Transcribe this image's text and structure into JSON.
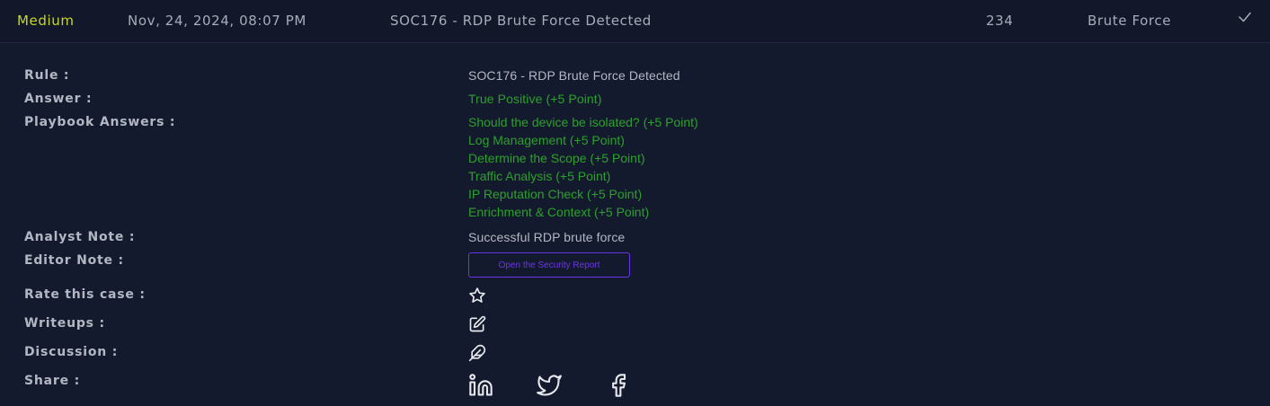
{
  "header": {
    "severity": "Medium",
    "date": "Nov, 24, 2024, 08:07 PM",
    "rule_name": "SOC176 - RDP Brute Force Detected",
    "event_id": "234",
    "type": "Brute Force",
    "check_icon": "checkmark-icon"
  },
  "details": {
    "rule_label": "Rule :",
    "rule_value": "SOC176 - RDP Brute Force Detected",
    "answer_label": "Answer :",
    "answer_value": "True Positive (+5 Point)",
    "playbook_label": "Playbook Answers :",
    "playbook_answers": [
      "Should the device be isolated? (+5 Point)",
      "Log Management (+5 Point)",
      "Determine the Scope (+5 Point)",
      "Traffic Analysis (+5 Point)",
      "IP Reputation Check (+5 Point)",
      "Enrichment & Context (+5 Point)"
    ],
    "analyst_note_label": "Analyst Note :",
    "analyst_note_value": "Successful RDP brute force",
    "editor_note_label": "Editor Note :",
    "report_button": "Open the Security Report",
    "rate_label": "Rate this case :",
    "rate_icon": "star-icon",
    "writeups_label": "Writeups :",
    "writeups_icon": "edit-icon",
    "discussion_label": "Discussion :",
    "discussion_icon": "feather-icon",
    "share_label": "Share :",
    "share_icons": [
      "linkedin-icon",
      "twitter-icon",
      "facebook-icon"
    ]
  },
  "colors": {
    "background": "#141a2d",
    "severity_medium": "#c6d62c",
    "positive_green": "#2aa12a",
    "accent_purple": "#6a35e8",
    "text_gray": "#b3b7c3"
  }
}
